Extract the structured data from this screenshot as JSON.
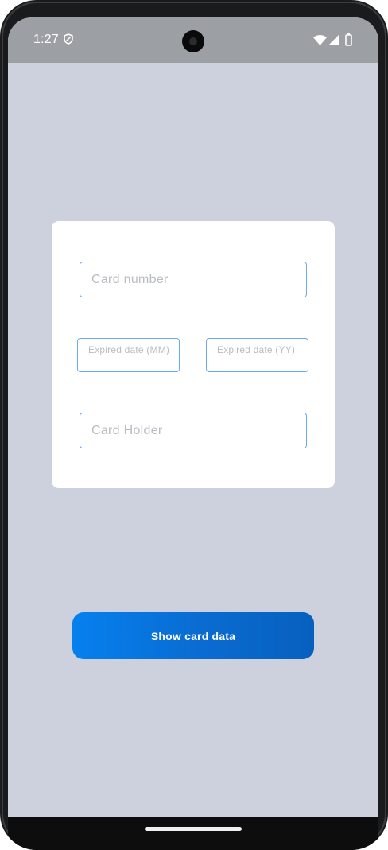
{
  "status_bar": {
    "time": "1:27",
    "icons": [
      "shield-icon",
      "wifi-icon",
      "cellular-signal-icon",
      "battery-icon"
    ]
  },
  "form": {
    "card_number_placeholder": "Card number",
    "expiry_month_placeholder": "Expired date (MM)",
    "expiry_year_placeholder": "Expired date (YY)",
    "card_holder_placeholder": "Card Holder"
  },
  "actions": {
    "show_button_label": "Show card data"
  },
  "colors": {
    "screen_background": "#cdd1dd",
    "card_background": "#ffffff",
    "field_border": "#6aa8f0",
    "button_gradient_start": "#0680ee",
    "button_gradient_end": "#0760be"
  }
}
